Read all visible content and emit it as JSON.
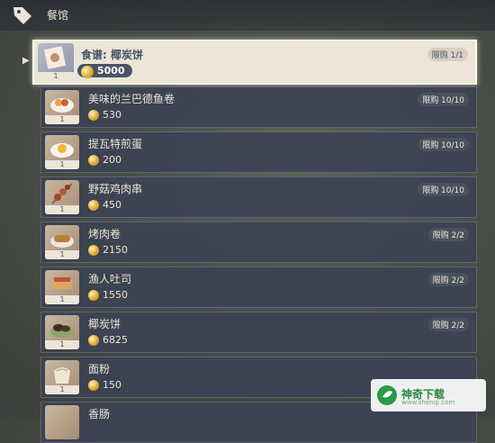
{
  "header": {
    "title": "餐馆",
    "icon": "tag-icon"
  },
  "items": [
    {
      "name": "食谱: 椰炭饼",
      "price": "5000",
      "limit": "限购 1/1",
      "count": "1",
      "icon": "recipe-icon",
      "selected": true
    },
    {
      "name": "美味的兰巴德鱼卷",
      "price": "530",
      "limit": "限购 10/10",
      "count": "1",
      "icon": "fish-roll-icon"
    },
    {
      "name": "提瓦特煎蛋",
      "price": "200",
      "limit": "限购 10/10",
      "count": "1",
      "icon": "fried-egg-icon"
    },
    {
      "name": "野菇鸡肉串",
      "price": "450",
      "limit": "限购 10/10",
      "count": "1",
      "icon": "skewer-icon"
    },
    {
      "name": "烤肉卷",
      "price": "2150",
      "limit": "限购 2/2",
      "count": "1",
      "icon": "meat-roll-icon"
    },
    {
      "name": "渔人吐司",
      "price": "1550",
      "limit": "限购 2/2",
      "count": "1",
      "icon": "toast-icon"
    },
    {
      "name": "椰炭饼",
      "price": "6825",
      "limit": "限购 2/2",
      "count": "1",
      "icon": "cake-icon"
    },
    {
      "name": "面粉",
      "price": "150",
      "limit": "",
      "count": "1",
      "icon": "flour-icon"
    },
    {
      "name": "香肠",
      "price": "",
      "limit": "",
      "count": "",
      "icon": "sausage-icon"
    }
  ],
  "watermark": {
    "text": "神奇下载",
    "subtext": "www.shenqi.com"
  },
  "colors": {
    "accent": "#ece5d8",
    "panel": "#3c4252",
    "coin": "#d9a62e"
  }
}
